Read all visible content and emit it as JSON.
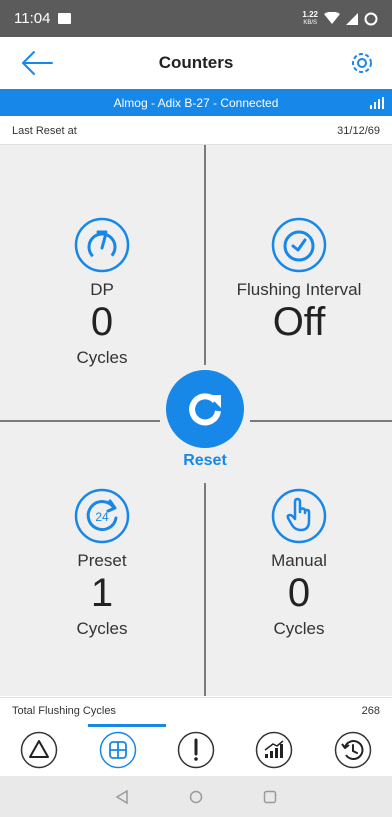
{
  "status_bar": {
    "time": "11:04",
    "speed_value": "1.22",
    "speed_unit": "KB/S"
  },
  "app_bar": {
    "title": "Counters"
  },
  "connection": {
    "text": "Almog - Adix B-27 - Connected"
  },
  "last_reset": {
    "label": "Last Reset at",
    "value": "31/12/69"
  },
  "counters": {
    "dp": {
      "label": "DP",
      "value": "0",
      "unit": "Cycles"
    },
    "flushing_interval": {
      "label": "Flushing Interval",
      "value": "Off"
    },
    "preset": {
      "label": "Preset",
      "value": "1",
      "unit": "Cycles",
      "badge": "24"
    },
    "manual": {
      "label": "Manual",
      "value": "0",
      "unit": "Cycles"
    }
  },
  "reset": {
    "label": "Reset"
  },
  "total": {
    "label": "Total Flushing Cycles",
    "value": "268"
  },
  "colors": {
    "accent": "#1787e8",
    "status_bar": "#5b5b5b",
    "grid_bg": "#efefef",
    "divider": "#7a7a7a"
  },
  "bottom_nav": [
    {
      "icon": "warning-triangle-icon"
    },
    {
      "icon": "grid-dashboard-icon",
      "active": true
    },
    {
      "icon": "alert-exclamation-icon"
    },
    {
      "icon": "signal-chart-icon"
    },
    {
      "icon": "history-clock-icon"
    }
  ]
}
